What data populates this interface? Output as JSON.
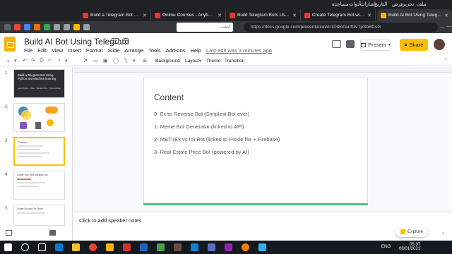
{
  "os_bar": {
    "items": [
      "ملف",
      "تحرير",
      "عرض",
      "التاريخ",
      "إشارات",
      "أدوات",
      "مساعدة"
    ]
  },
  "tabs": [
    {
      "label": "Build a Telegram Bot Using Py",
      "active": false,
      "color": "#e53935"
    },
    {
      "label": "Online Courses - Anytime, An",
      "active": false,
      "color": "#e53935"
    },
    {
      "label": "Build Telegram Bots Using Py",
      "active": false,
      "color": "#e53935"
    },
    {
      "label": "Create Telegram Bot with Pyth",
      "active": false,
      "color": "#e53935"
    },
    {
      "label": "Build AI Bot Using Telegram -",
      "active": true,
      "color": "#f4b400"
    }
  ],
  "address": {
    "url": "https://docs.google.com/presentation/d/1Di2o0anfOvTpSbBCsG",
    "rtl_search_placeholder": "ابحث"
  },
  "header": {
    "title": "Build AI Bot Using Telegram",
    "menus": [
      "File",
      "Edit",
      "View",
      "Insert",
      "Format",
      "Slide",
      "Arrange",
      "Tools",
      "Add-ons",
      "Help"
    ],
    "last_edit": "Last edit was 3 minutes ago",
    "present_label": "Present",
    "share_label": "Share"
  },
  "toolbar": {
    "background_label": "Background",
    "layout_label": "Layout",
    "theme_label": "Theme",
    "transition_label": "Transition"
  },
  "filmstrip": {
    "slides": [
      {
        "number": "1",
        "title": "Build a Telegram Bot Using Python and Machine learning",
        "subtitle": "Learn Python - Flask - Telegram Bot - Python Heroku",
        "dark": true
      },
      {
        "number": "2",
        "title": "",
        "dark": false
      },
      {
        "number": "3",
        "title": "Content",
        "selected": true,
        "dark": false
      },
      {
        "number": "4",
        "title": "Create Your First Telegram Bot",
        "dark": false
      },
      {
        "number": "5",
        "title": "Create Bot and Get Token",
        "dark": false
      }
    ]
  },
  "slide": {
    "title": "Content",
    "bullets": [
      "0- Echo Reverse Bot (Simplest Bot ever)",
      "1- Meme Bot Generator (linked to API)",
      "2- MBTI(Ex vs In) Bot (linked to Pickle file + Firebase)",
      "3- Real Estate Price Bot (powered by AI)"
    ],
    "accent_color": "#57bb8a"
  },
  "notes": {
    "placeholder": "Click to add speaker notes"
  },
  "explore": {
    "label": "Explore"
  },
  "taskbar": {
    "language": "ENG",
    "time": "05:37",
    "date": "09/01/2021"
  }
}
